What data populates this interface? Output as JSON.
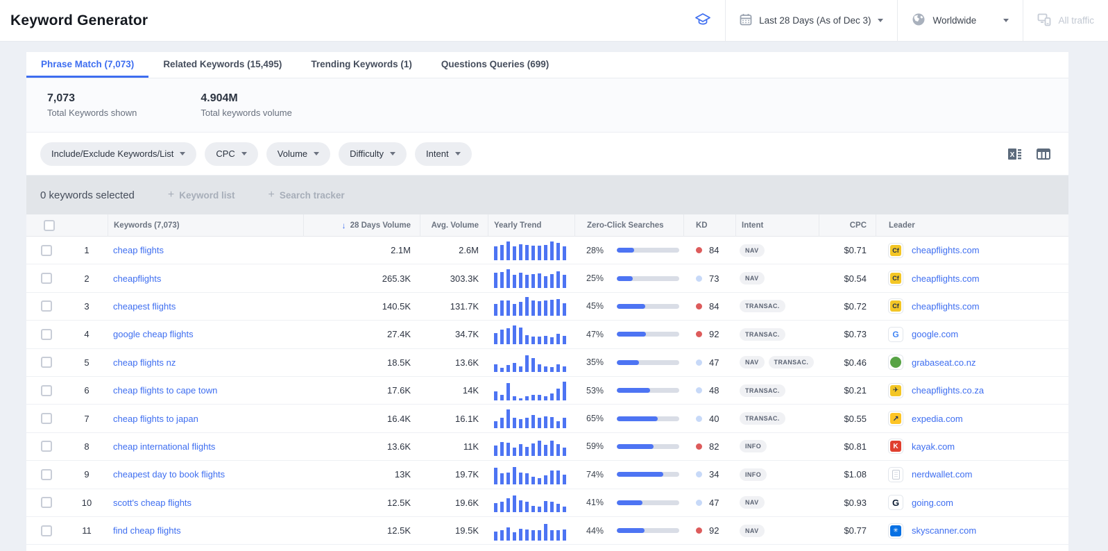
{
  "header": {
    "title": "Keyword Generator",
    "controls": {
      "date_label": "Last 28 Days (As of Dec 3)",
      "region_label": "Worldwide",
      "traffic_label": "All traffic"
    }
  },
  "tabs": [
    {
      "id": "phrase-match",
      "label": "Phrase Match (7,073)",
      "active": true
    },
    {
      "id": "related-keywords",
      "label": "Related Keywords (15,495)",
      "active": false
    },
    {
      "id": "trending-keywords",
      "label": "Trending Keywords (1)",
      "active": false
    },
    {
      "id": "questions-queries",
      "label": "Questions Queries (699)",
      "active": false
    }
  ],
  "summary": {
    "keywords_value": "7,073",
    "keywords_label": "Total Keywords shown",
    "volume_value": "4.904M",
    "volume_label": "Total keywords volume"
  },
  "filters": [
    {
      "id": "include-exclude",
      "label": "Include/Exclude Keywords/List"
    },
    {
      "id": "cpc",
      "label": "CPC"
    },
    {
      "id": "volume",
      "label": "Volume"
    },
    {
      "id": "difficulty",
      "label": "Difficulty"
    },
    {
      "id": "intent",
      "label": "Intent"
    }
  ],
  "selection_bar": {
    "selected_text": "0 keywords selected",
    "plus_glyph": "+",
    "keyword_list_label": "Keyword list",
    "search_tracker_label": "Search tracker"
  },
  "table": {
    "sort_icon": "↓",
    "columns": {
      "keywords": "Keywords (7,073)",
      "volume_28d": "28 Days Volume",
      "avg_volume": "Avg. Volume",
      "yearly_trend": "Yearly Trend",
      "zero_click": "Zero-Click Searches",
      "kd": "KD",
      "intent": "Intent",
      "cpc": "CPC",
      "leader": "Leader"
    },
    "rows": [
      {
        "rank": "1",
        "keyword": "cheap flights",
        "volume_28d": "2.1M",
        "avg_volume": "2.6M",
        "trend": [
          72,
          78,
          95,
          72,
          82,
          78,
          75,
          75,
          80,
          95,
          88,
          70
        ],
        "zero_click": "28%",
        "zero_click_pct": 28,
        "kd": 84,
        "intents": [
          "NAV"
        ],
        "cpc": "$0.71",
        "leader": "cheapflights.com",
        "favicon": "cheapflights"
      },
      {
        "rank": "2",
        "keyword": "cheapflights",
        "volume_28d": "265.3K",
        "avg_volume": "303.3K",
        "trend": [
          78,
          82,
          95,
          68,
          78,
          68,
          72,
          75,
          62,
          70,
          85,
          68
        ],
        "zero_click": "25%",
        "zero_click_pct": 25,
        "kd": 73,
        "intents": [
          "NAV"
        ],
        "cpc": "$0.54",
        "leader": "cheapflights.com",
        "favicon": "cheapflights"
      },
      {
        "rank": "3",
        "keyword": "cheapest flights",
        "volume_28d": "140.5K",
        "avg_volume": "131.7K",
        "trend": [
          62,
          78,
          80,
          60,
          72,
          95,
          78,
          75,
          80,
          82,
          85,
          64
        ],
        "zero_click": "45%",
        "zero_click_pct": 45,
        "kd": 84,
        "intents": [
          "TRANSAC."
        ],
        "cpc": "$0.72",
        "leader": "cheapflights.com",
        "favicon": "cheapflights"
      },
      {
        "rank": "4",
        "keyword": "google cheap flights",
        "volume_28d": "27.4K",
        "avg_volume": "34.7K",
        "trend": [
          58,
          75,
          82,
          95,
          85,
          45,
          38,
          40,
          42,
          36,
          52,
          42
        ],
        "zero_click": "47%",
        "zero_click_pct": 47,
        "kd": 92,
        "intents": [
          "TRANSAC."
        ],
        "cpc": "$0.73",
        "leader": "google.com",
        "favicon": "google"
      },
      {
        "rank": "5",
        "keyword": "cheap flights nz",
        "volume_28d": "18.5K",
        "avg_volume": "13.6K",
        "trend": [
          40,
          20,
          35,
          48,
          28,
          85,
          70,
          40,
          28,
          25,
          40,
          28
        ],
        "zero_click": "35%",
        "zero_click_pct": 35,
        "kd": 47,
        "intents": [
          "NAV",
          "TRANSAC."
        ],
        "cpc": "$0.46",
        "leader": "grabaseat.co.nz",
        "favicon": "grabaseat"
      },
      {
        "rank": "6",
        "keyword": "cheap flights to cape town",
        "volume_28d": "17.6K",
        "avg_volume": "14K",
        "trend": [
          45,
          28,
          88,
          20,
          12,
          20,
          28,
          30,
          20,
          35,
          60,
          95
        ],
        "zero_click": "53%",
        "zero_click_pct": 53,
        "kd": 48,
        "intents": [
          "TRANSAC."
        ],
        "cpc": "$0.21",
        "leader": "cheapflights.co.za",
        "favicon": "plane"
      },
      {
        "rank": "7",
        "keyword": "cheap flights to japan",
        "volume_28d": "16.4K",
        "avg_volume": "16.1K",
        "trend": [
          35,
          55,
          95,
          52,
          48,
          55,
          68,
          55,
          60,
          58,
          35,
          52
        ],
        "zero_click": "65%",
        "zero_click_pct": 65,
        "kd": 40,
        "intents": [
          "TRANSAC."
        ],
        "cpc": "$0.55",
        "leader": "expedia.com",
        "favicon": "expedia"
      },
      {
        "rank": "8",
        "keyword": "cheap international flights",
        "volume_28d": "13.6K",
        "avg_volume": "11K",
        "trend": [
          52,
          72,
          68,
          42,
          60,
          48,
          65,
          78,
          58,
          78,
          62,
          42
        ],
        "zero_click": "59%",
        "zero_click_pct": 59,
        "kd": 82,
        "intents": [
          "INFO"
        ],
        "cpc": "$0.81",
        "leader": "kayak.com",
        "favicon": "kayak"
      },
      {
        "rank": "9",
        "keyword": "cheapest day to book flights",
        "volume_28d": "13K",
        "avg_volume": "19.7K",
        "trend": [
          85,
          58,
          60,
          90,
          62,
          58,
          38,
          32,
          48,
          70,
          72,
          50
        ],
        "zero_click": "74%",
        "zero_click_pct": 74,
        "kd": 34,
        "intents": [
          "INFO"
        ],
        "cpc": "$1.08",
        "leader": "nerdwallet.com",
        "favicon": "nerdwallet"
      },
      {
        "rank": "10",
        "keyword": "scott's cheap flights",
        "volume_28d": "12.5K",
        "avg_volume": "19.6K",
        "trend": [
          48,
          52,
          72,
          85,
          62,
          52,
          32,
          28,
          58,
          52,
          42,
          28
        ],
        "zero_click": "41%",
        "zero_click_pct": 41,
        "kd": 47,
        "intents": [
          "NAV"
        ],
        "cpc": "$0.93",
        "leader": "going.com",
        "favicon": "going"
      },
      {
        "rank": "11",
        "keyword": "find cheap flights",
        "volume_28d": "12.5K",
        "avg_volume": "19.5K",
        "trend": [
          48,
          52,
          68,
          42,
          62,
          58,
          55,
          52,
          85,
          52,
          55,
          58
        ],
        "zero_click": "44%",
        "zero_click_pct": 44,
        "kd": 92,
        "intents": [
          "NAV"
        ],
        "cpc": "$0.77",
        "leader": "skyscanner.com",
        "favicon": "skyscanner"
      }
    ]
  },
  "colors": {
    "accent_blue": "#3e6ef0",
    "bar_blue": "#4d74f3",
    "kd_high": "#dd5b5b",
    "kd_low": "#c7d9f8"
  }
}
